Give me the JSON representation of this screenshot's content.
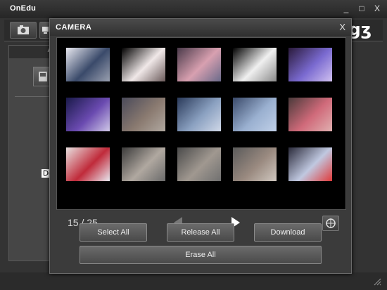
{
  "app": {
    "title": "OnEdu",
    "brand": "gʒ"
  },
  "window_controls": {
    "minimize": "_",
    "maximize": "□",
    "close": "X"
  },
  "left_panel": {
    "header": "A",
    "label": "De"
  },
  "dialog": {
    "title": "CAMERA",
    "close": "X",
    "counter": "15 / 25",
    "buttons": {
      "select_all": "Select All",
      "release_all": "Release All",
      "download": "Download",
      "erase_all": "Erase All"
    }
  },
  "thumbnails": [
    {
      "id": "photo-office-people",
      "colors": [
        "#e8e8f0",
        "#3a4a6a",
        "#9aa0b0"
      ]
    },
    {
      "id": "photo-blossom-night",
      "colors": [
        "#000000",
        "#f0e8e8",
        "#6a5a5a"
      ]
    },
    {
      "id": "photo-pink-trees",
      "colors": [
        "#4a3a4a",
        "#d8a0b0",
        "#6a6a8a"
      ]
    },
    {
      "id": "photo-blossom-white",
      "colors": [
        "#000000",
        "#f0f0f0",
        "#8a8a8a"
      ]
    },
    {
      "id": "photo-purple-pond",
      "colors": [
        "#2a1a3a",
        "#7a6ad0",
        "#d0c0f0"
      ]
    },
    {
      "id": "photo-purple-street",
      "colors": [
        "#1a1a4a",
        "#6a4ab0",
        "#d0c8e8"
      ]
    },
    {
      "id": "photo-blurry-people",
      "colors": [
        "#4a4a5a",
        "#8a7a70",
        "#b0a8a0"
      ]
    },
    {
      "id": "photo-blue-blur",
      "colors": [
        "#2a3a5a",
        "#8aa0c0",
        "#d0d8e8"
      ]
    },
    {
      "id": "photo-blue-glow",
      "colors": [
        "#3a4a6a",
        "#9ab0d0",
        "#c0d0e8"
      ]
    },
    {
      "id": "photo-pink-flowers",
      "colors": [
        "#4a3a3a",
        "#d06a7a",
        "#e0b0b0"
      ]
    },
    {
      "id": "photo-red-flowers",
      "colors": [
        "#e8e0e0",
        "#c02a3a",
        "#e8e8f0"
      ]
    },
    {
      "id": "photo-classroom-1",
      "colors": [
        "#3a3a3a",
        "#b0a8a0",
        "#6a6a6a"
      ]
    },
    {
      "id": "photo-classroom-2",
      "colors": [
        "#4a4a4a",
        "#a09890",
        "#707070"
      ]
    },
    {
      "id": "photo-classroom-3",
      "colors": [
        "#5a5a5a",
        "#9a8a80",
        "#d0c8c0"
      ]
    },
    {
      "id": "photo-computer-screen",
      "colors": [
        "#2a2a3a",
        "#c0c8e0",
        "#e03a3a"
      ]
    }
  ]
}
